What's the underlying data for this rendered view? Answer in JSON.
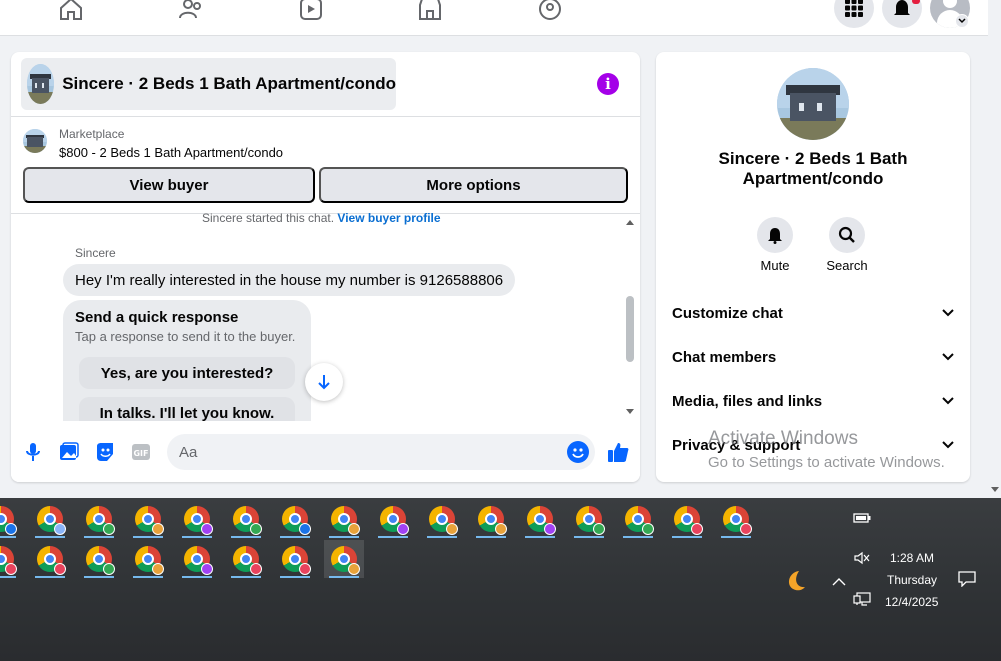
{
  "nav": {
    "icons": [
      "home-icon",
      "friends-icon",
      "video-icon",
      "marketplace-icon",
      "groups-icon"
    ],
    "right_icons": [
      "menu-grid-icon",
      "notifications-icon",
      "profile-avatar"
    ]
  },
  "chat": {
    "title": "Sincere · 2 Beds 1 Bath Apartment/condo",
    "marketplace_label": "Marketplace",
    "listing": "$800 - 2 Beds 1 Bath Apartment/condo",
    "view_buyer": "View buyer",
    "more_options": "More options",
    "started_text": "Sincere started this chat.",
    "view_profile": "View buyer profile",
    "sender": "Sincere",
    "message": "Hey I'm really interested in the house my number is 9126588806",
    "quick_title": "Send a quick response",
    "quick_sub": "Tap a response to send it to the buyer.",
    "quick_responses": [
      "Yes, are you interested?",
      "In talks. I'll let you know."
    ],
    "composer_placeholder": "Aa",
    "accent": "#0866ff",
    "info_color": "#a400e8"
  },
  "info_panel": {
    "title": "Sincere · 2 Beds 1 Bath Apartment/condo",
    "actions": [
      "Mute",
      "Search"
    ],
    "sections": [
      "Customize chat",
      "Chat members",
      "Media, files and links",
      "Privacy & support"
    ]
  },
  "watermark": {
    "line1": "Activate Windows",
    "line2": "Go to Settings to activate Windows."
  },
  "taskbar": {
    "badge_colors": [
      "#1a73e8",
      "#8ab4f8",
      "#34a853",
      "#e8a23a",
      "#a142f4",
      "#34a853",
      "#1a73e8",
      "#e8a23a",
      "#a142f4",
      "#e8a23a",
      "#e8a23a",
      "#a142f4",
      "#34a853",
      "#34a853",
      "#e8435d",
      "#e8435d"
    ],
    "row2_badge_colors": [
      "#e8435d",
      "#e8435d",
      "#34a853",
      "#e8a23a",
      "#a142f4",
      "#e8435d",
      "#e8435d",
      "#e8a23a"
    ],
    "time": "1:28 AM",
    "day": "Thursday",
    "date": "12/4/2025"
  }
}
